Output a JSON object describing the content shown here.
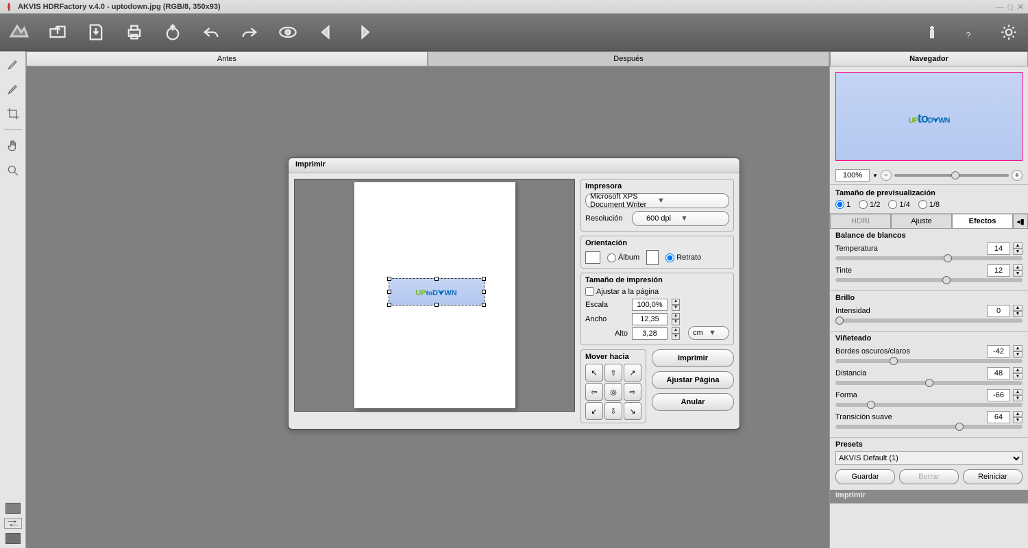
{
  "window": {
    "title": "AKVIS HDRFactory v.4.0 - uptodown.jpg (RGB/8, 350x93)"
  },
  "tabs": {
    "before": "Antes",
    "after": "Después"
  },
  "navigator": {
    "title": "Navegador",
    "zoom": "100%",
    "preview_size_title": "Tamaño de previsualización",
    "sizes": [
      "1",
      "1/2",
      "1/4",
      "1/8"
    ]
  },
  "subtabs": {
    "hdri": "HDRI",
    "ajuste": "Ajuste",
    "efectos": "Efectos"
  },
  "effects": {
    "white_balance": {
      "title": "Balance de blancos",
      "temperature_label": "Temperatura",
      "temperature": "14",
      "tint_label": "Tinte",
      "tint": "12"
    },
    "brightness": {
      "title": "Brillo",
      "intensity_label": "Intensidad",
      "intensity": "0"
    },
    "vignette": {
      "title": "Viñeteado",
      "edges_label": "Bordes oscuros/claros",
      "edges": "-42",
      "distance_label": "Distancia",
      "distance": "48",
      "shape_label": "Forma",
      "shape": "-66",
      "transition_label": "Transición suave",
      "transition": "64"
    }
  },
  "presets": {
    "title": "Presets",
    "selected": "AKVIS Default (1)",
    "save": "Guardar",
    "delete": "Borrar",
    "reset": "Reiniciar"
  },
  "print_bar": "Imprimir",
  "dialog": {
    "title": "Imprimir",
    "printer": {
      "title": "Impresora",
      "selected": "Microsoft XPS Document Writer",
      "resolution_label": "Resolución",
      "resolution": "600 dpi"
    },
    "orientation": {
      "title": "Orientación",
      "album": "Álbum",
      "portrait": "Retrato"
    },
    "print_size": {
      "title": "Tamaño de impresión",
      "fit": "Ajustar a la página",
      "scale_label": "Escala",
      "scale": "100,0%",
      "width_label": "Ancho",
      "width": "12,35",
      "height_label": "Alto",
      "height": "3,28",
      "unit": "cm"
    },
    "move": {
      "title": "Mover hacia"
    },
    "actions": {
      "print": "Imprimir",
      "fit_page": "Ajustar Página",
      "cancel": "Anular"
    }
  },
  "logo": {
    "up": "UP",
    "to": "to",
    "down": "D⮟WN"
  }
}
